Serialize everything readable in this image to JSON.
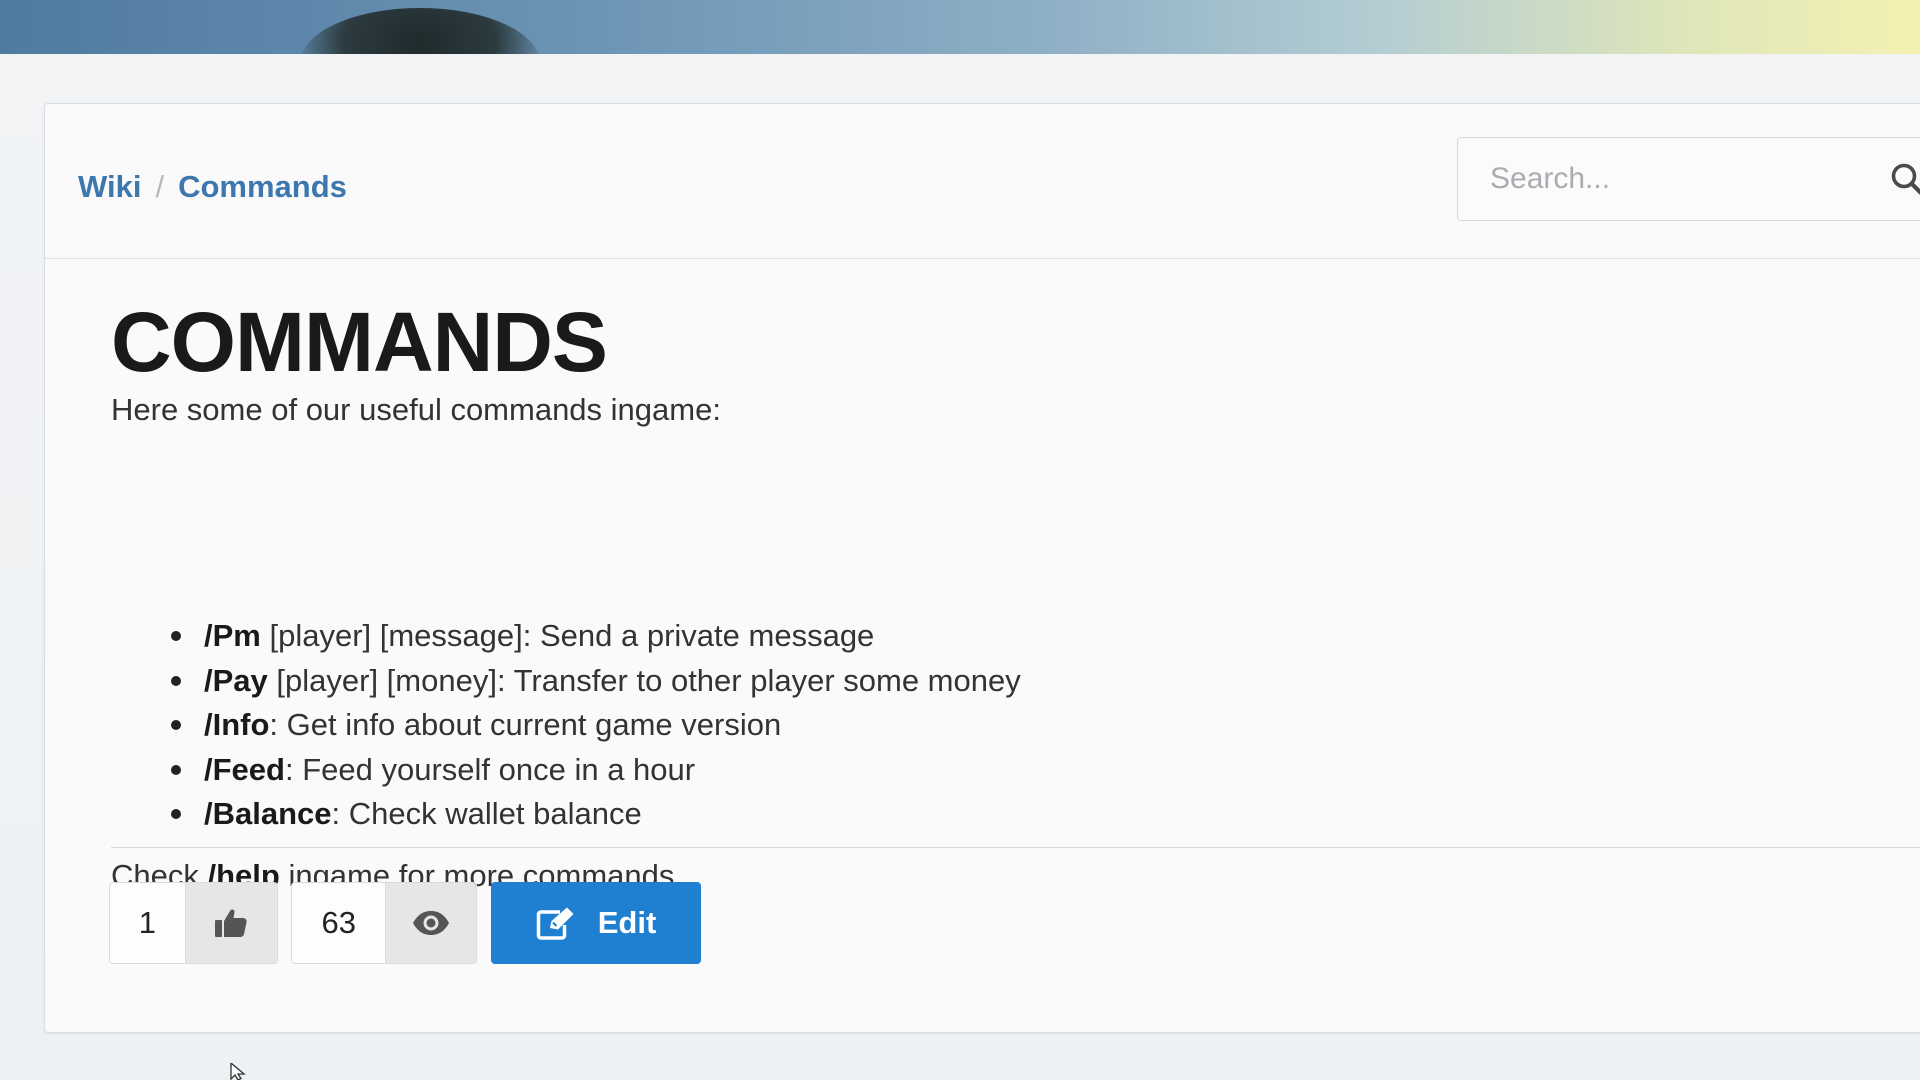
{
  "breadcrumb": {
    "items": [
      "Wiki",
      "Commands"
    ],
    "separator": "/"
  },
  "search": {
    "placeholder": "Search...",
    "icon": "search-icon"
  },
  "page": {
    "title": "COMMANDS",
    "intro": "Here some of our useful commands ingame:",
    "commands": [
      {
        "cmd": "/Pm",
        "args": " [player] [message]",
        "desc": ": Send a private message"
      },
      {
        "cmd": "/Pay",
        "args": " [player] [money]",
        "desc": ": Transfer to other player some money"
      },
      {
        "cmd": "/Info",
        "args": "",
        "desc": ": Get info about current game version"
      },
      {
        "cmd": "/Feed",
        "args": "",
        "desc": ": Feed yourself once in a hour"
      },
      {
        "cmd": "/Balance",
        "args": "",
        "desc": ": Check wallet balance"
      }
    ],
    "note_prefix": "Check ",
    "note_cmd": "/help",
    "note_suffix": " ingame for more commands."
  },
  "actions": {
    "likes": "1",
    "like_icon": "thumbs-up-icon",
    "views": "63",
    "view_icon": "eye-icon",
    "edit_label": "Edit",
    "edit_icon": "edit-icon"
  },
  "colors": {
    "link": "#3c77ad",
    "accent": "#1f80d2"
  }
}
